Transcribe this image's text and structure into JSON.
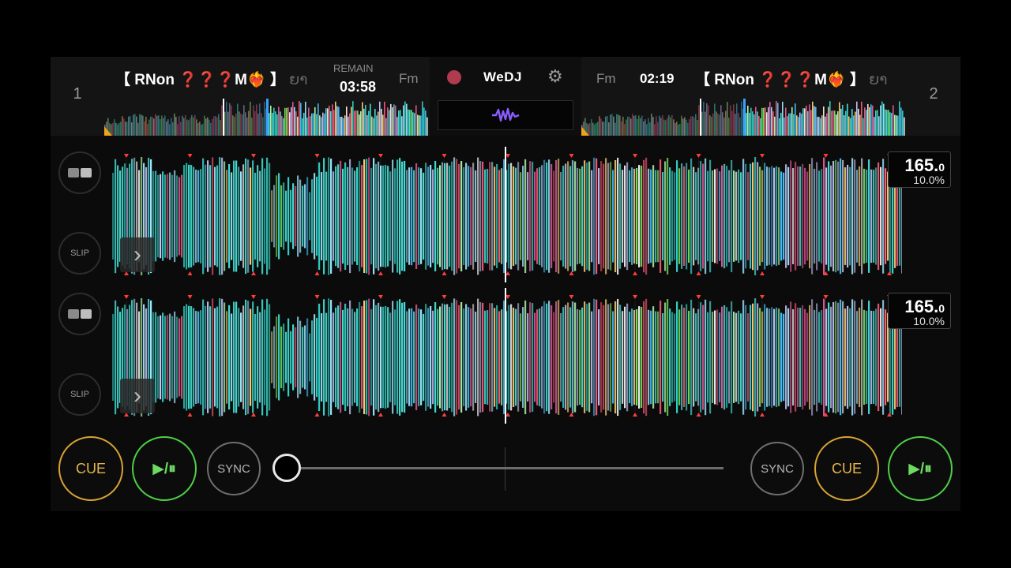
{
  "app": {
    "brand": "WeDJ",
    "settings_icon": "gear-icon",
    "fx_icon": "waveform-icon"
  },
  "colors": {
    "cue": "#d8a333",
    "play": "#4fcf46",
    "record": "#b03a4e"
  },
  "deck1": {
    "number": "1",
    "title": "【 RNon ❓❓❓M❤️‍🔥 】",
    "title_overflow": "ຍາ",
    "remain_label": "REMAIN",
    "remain_time": "03:58",
    "key": "Fm",
    "bpm_main": "165.",
    "bpm_decimal": "0",
    "pitch": "10.0%",
    "slip_label": "SLIP",
    "cue_label": "CUE",
    "play_label": "▶/⏸",
    "sync_label": "SYNC"
  },
  "deck2": {
    "number": "2",
    "title": "【 RNon ❓❓❓M❤️‍🔥 】",
    "title_overflow": "ຍາ",
    "time": "02:19",
    "key": "Fm",
    "bpm_main": "165.",
    "bpm_decimal": "0",
    "pitch": "10.0%",
    "slip_label": "SLIP",
    "cue_label": "CUE",
    "play_label": "▶/⏸",
    "sync_label": "SYNC"
  },
  "crossfader": {
    "position": 0.0
  }
}
